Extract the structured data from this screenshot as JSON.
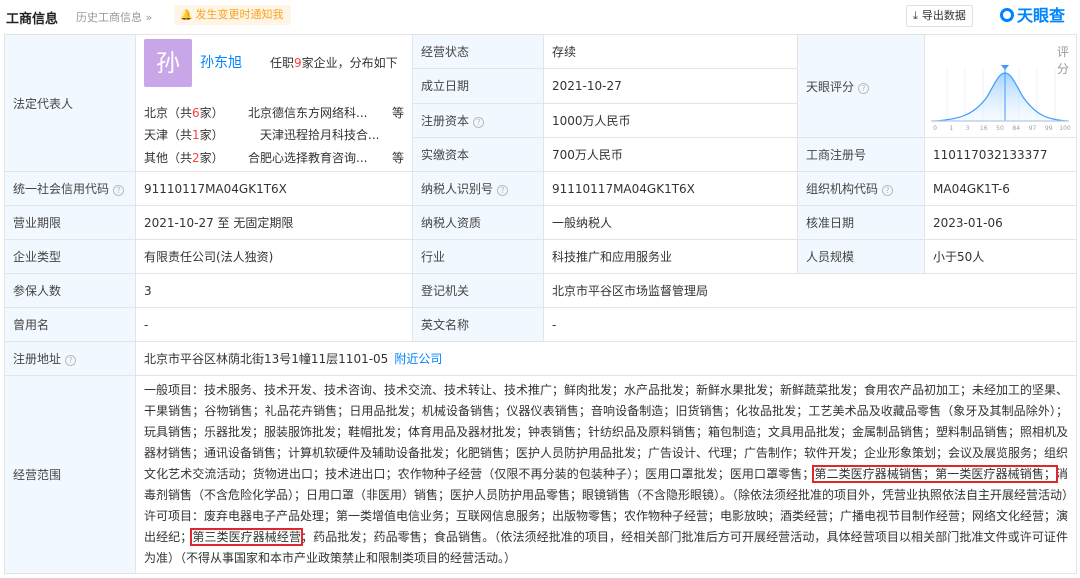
{
  "header": {
    "title": "工商信息",
    "history": "历史工商信息",
    "history_count": "»",
    "notify": "发生变更时通知我",
    "export": "导出数据",
    "logo": "天眼查"
  },
  "legal": {
    "label": "法定代表人",
    "avatar_char": "孙",
    "name": "孙东旭",
    "desc_prefix": "任职",
    "desc_count": "9",
    "desc_suffix": "家企业，分布如下",
    "regions": [
      {
        "region": "北京（共",
        "count": "6",
        "tail": "家）",
        "company": "北京德信东方网络科...",
        "more": "等"
      },
      {
        "region": "天津（共",
        "count": "1",
        "tail": "家）",
        "company": "天津迅程拾月科技合...",
        "more": ""
      },
      {
        "region": "其他（共",
        "count": "2",
        "tail": "家）",
        "company": "合肥心选择教育咨询...",
        "more": "等"
      }
    ]
  },
  "rows": {
    "status_label": "经营状态",
    "status_value": "存续",
    "found_label": "成立日期",
    "found_value": "2021-10-27",
    "regcap_label": "注册资本",
    "regcap_value": "1000万人民币",
    "paidcap_label": "实缴资本",
    "paidcap_value": "700万人民币",
    "score_label": "天眼评分",
    "regno_label": "工商注册号",
    "regno_value": "110117032133377",
    "credit_label": "统一社会信用代码",
    "credit_value": "91110117MA04GK1T6X",
    "taxid_label": "纳税人识别号",
    "taxid_value": "91110117MA04GK1T6X",
    "orgcode_label": "组织机构代码",
    "orgcode_value": "MA04GK1T-6",
    "term_label": "营业期限",
    "term_value": "2021-10-27 至 无固定期限",
    "taxq_label": "纳税人资质",
    "taxq_value": "一般纳税人",
    "approve_label": "核准日期",
    "approve_value": "2023-01-06",
    "type_label": "企业类型",
    "type_value": "有限责任公司(法人独资)",
    "industry_label": "行业",
    "industry_value": "科技推广和应用服务业",
    "staff_label": "人员规模",
    "staff_value": "小于50人",
    "insured_label": "参保人数",
    "insured_value": "3",
    "authority_label": "登记机关",
    "authority_value": "北京市平谷区市场监督管理局",
    "former_label": "曾用名",
    "former_value": "-",
    "en_label": "英文名称",
    "en_value": "-",
    "addr_label": "注册地址",
    "addr_value": "北京市平谷区林荫北街13号1幢11层1101-05",
    "addr_link": "附近公司",
    "scope_label": "经营范围"
  },
  "score": {
    "label": "评分",
    "value": "73",
    "ticks": [
      "0",
      "1",
      "3",
      "16",
      "50",
      "84",
      "97",
      "99",
      "100"
    ]
  },
  "scope": {
    "part1": "一般项目：技术服务、技术开发、技术咨询、技术交流、技术转让、技术推广；鲜肉批发；水产品批发；新鲜水果批发；新鲜蔬菜批发；食用农产品初加工；未经加工的坚果、干果销售；谷物销售；礼品花卉销售；日用品批发；机械设备销售；仪器仪表销售；音响设备制造；旧货销售；化妆品批发；工艺美术品及收藏品零售（象牙及其制品除外）；玩具销售；乐器批发；服装服饰批发；鞋帽批发；体育用品及器材批发；钟表销售；针纺织品及原料销售；箱包制造；文具用品批发；金属制品销售；塑料制品销售；照相机及器材销售；通讯设备销售；计算机软硬件及辅助设备批发；化肥销售；医护人员防护用品批发；广告设计、代理；广告制作；软件开发；企业形象策划；会议及展览服务；组织文化艺术交流活动；货物进出口；技术进出口；农作物种子经营（仅限不再分装的包装种子）；医用口罩批发；医用口罩零售；",
    "hl1": "第二类医疗器械销售；第一类医疗器械销售；",
    "part2": "消毒剂销售（不含危险化学品）；日用口罩（非医用）销售；医护人员防护用品零售；眼镜销售（不含隐形眼镜）。（除依法须经批准的项目外，凭营业执照依法自主开展经营活动）许可项目：废弃电器电子产品处理；第一类增值电信业务；互联网信息服务；出版物零售；农作物种子经营；电影放映；酒类经营；广播电视节目制作经营；网络文化经营；演出经纪；",
    "hl2": "第三类医疗器械经营",
    "part3": "；药品批发；药品零售；食品销售。（依法须经批准的项目，经相关部门批准后方可开展经营活动，具体经营项目以相关部门批准文件或许可证件为准）（不得从事国家和本市产业政策禁止和限制类项目的经营活动。）"
  },
  "colors": {
    "accent": "#0084ff",
    "label_bg": "#f2f8ff",
    "highlight": "#e0272c"
  }
}
